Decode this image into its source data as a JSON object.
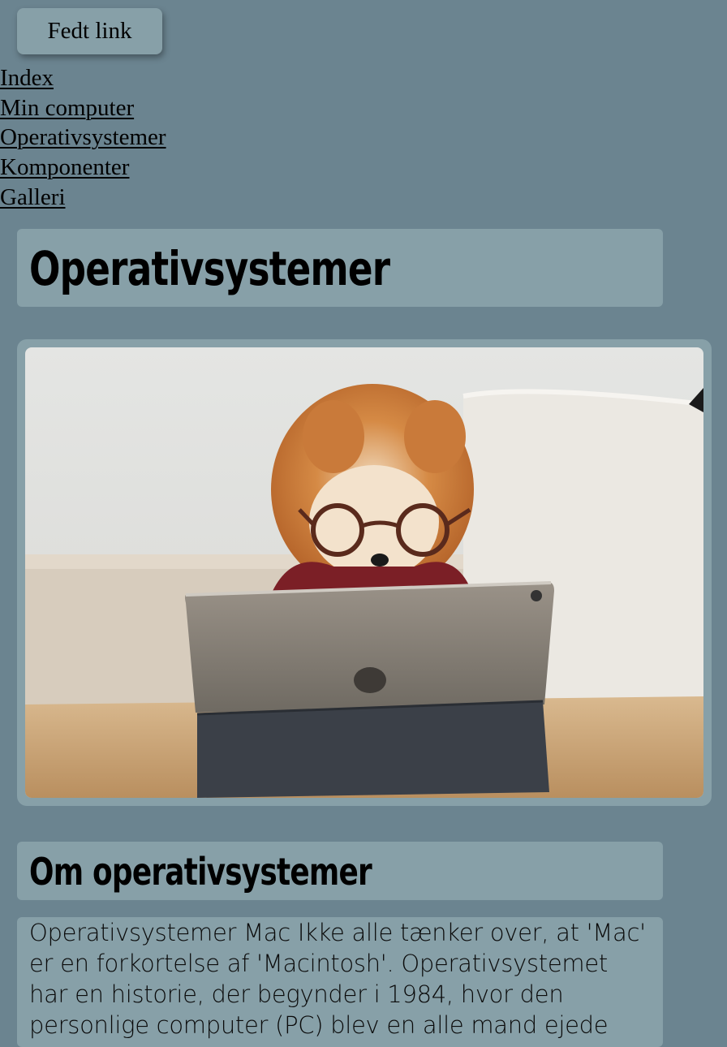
{
  "header": {
    "button_label": "Fedt link"
  },
  "nav": {
    "items": [
      "Index",
      "Min computer",
      "Operativsystemer",
      "Komponenter",
      "Galleri"
    ]
  },
  "page": {
    "title": "Operativsystemer"
  },
  "section": {
    "heading": "Om operativsystemer",
    "paragraph": "Operativsystemer Mac Ikke alle tænker over, at 'Mac' er en forkortelse af 'Macintosh'. Operativsystemet har en historie, der begynder i 1984, hvor den personlige computer (PC) blev en alle mand ejede"
  },
  "colors": {
    "background": "#6b8490",
    "panel": "#87a0a8"
  }
}
